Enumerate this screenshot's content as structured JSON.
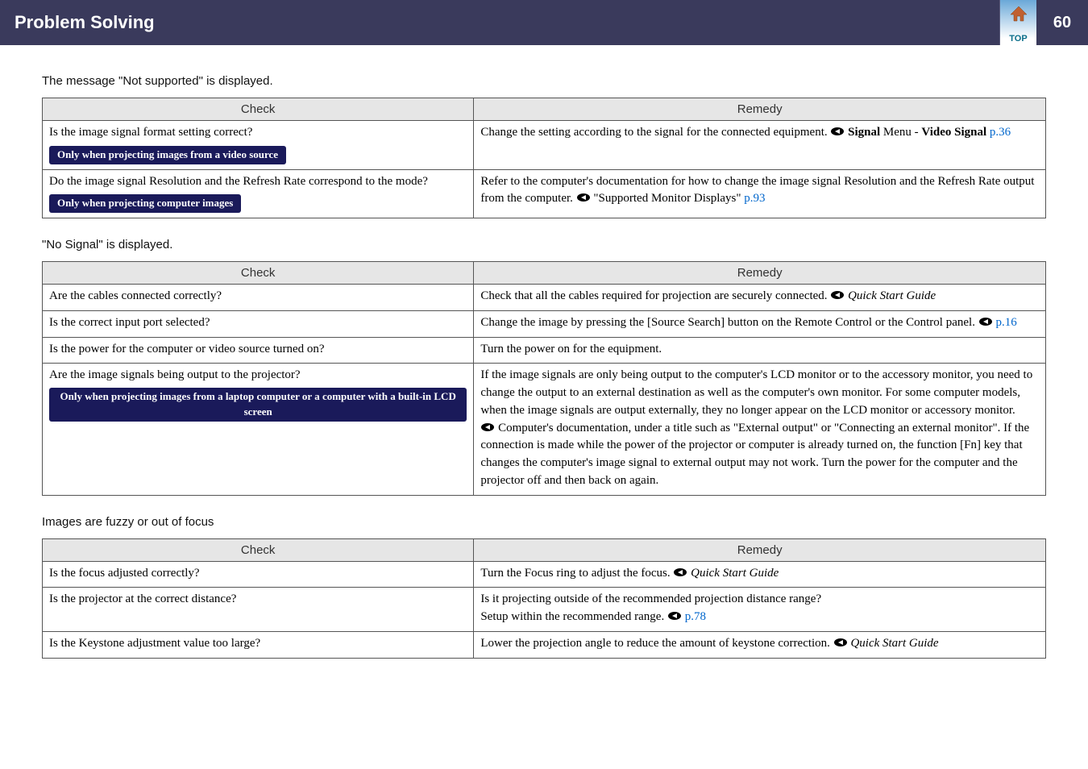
{
  "header": {
    "title": "Problem Solving",
    "topLabel": "TOP",
    "pageNumber": "60"
  },
  "section1": {
    "title": "The message \"Not supported\" is displayed.",
    "headers": {
      "check": "Check",
      "remedy": "Remedy"
    },
    "rows": [
      {
        "check_q": "Is the image signal format setting correct?",
        "check_pill": "Only when projecting images from a video source",
        "remedy_pre": "Change the setting according to the signal for the connected equipment. ",
        "remedy_bold1": "Signal",
        "remedy_mid": " Menu - ",
        "remedy_bold2": "Video Signal",
        "remedy_link": "p.36"
      },
      {
        "check_q": "Do the image signal Resolution and the Refresh Rate correspond to the mode?",
        "check_pill": "Only when projecting computer images",
        "remedy_line1": "Refer to the computer's documentation for how to change the image signal Resolution and the Refresh Rate output from the computer. ",
        "remedy_quoted": "\"Supported Monitor Displays\"",
        "remedy_link": "p.93"
      }
    ]
  },
  "section2": {
    "title": "\"No Signal\" is displayed.",
    "headers": {
      "check": "Check",
      "remedy": "Remedy"
    },
    "rows": [
      {
        "check": "Are the cables connected correctly?",
        "remedy_pre": "Check that all the cables required for projection are securely connected. ",
        "remedy_ital": "Quick Start Guide"
      },
      {
        "check": "Is the correct input port selected?",
        "remedy_pre": "Change the image by pressing the [Source Search] button on the Remote Control or the Control panel. ",
        "remedy_link": "p.16"
      },
      {
        "check": "Is the power for the computer or video source turned on?",
        "remedy": "Turn the power on for the equipment."
      },
      {
        "check_q": "Are the image signals being output to the projector?",
        "check_pill": "Only when projecting images from a laptop computer or a computer with a built-in LCD screen",
        "remedy_p1": "If the image signals are only being output to the computer's LCD monitor or to the accessory monitor, you need to change the output to an external destination as well as the computer's own monitor. For some computer models, when the image signals are output externally, they no longer appear on the LCD monitor or accessory monitor.",
        "remedy_p2": "Computer's documentation, under a title such as \"External output\" or \"Connecting an external monitor\". If the connection is made while the power of the projector or computer is already turned on, the function [Fn] key that changes the computer's image signal to external output may not work. Turn the power for the computer and the projector off and then back on again."
      }
    ]
  },
  "section3": {
    "title": "Images are fuzzy or out of focus",
    "headers": {
      "check": "Check",
      "remedy": "Remedy"
    },
    "rows": [
      {
        "check": "Is the focus adjusted correctly?",
        "remedy_pre": "Turn the Focus ring to adjust the focus. ",
        "remedy_ital": "Quick Start Guide"
      },
      {
        "check": "Is the projector at the correct distance?",
        "remedy_l1": "Is it projecting outside of the recommended projection distance range?",
        "remedy_l2_pre": "Setup within the recommended range. ",
        "remedy_link": "p.78"
      },
      {
        "check": "Is the Keystone adjustment value too large?",
        "remedy_pre": "Lower the projection angle to reduce the amount of keystone correction. ",
        "remedy_ital": "Quick Start Guide"
      }
    ]
  }
}
